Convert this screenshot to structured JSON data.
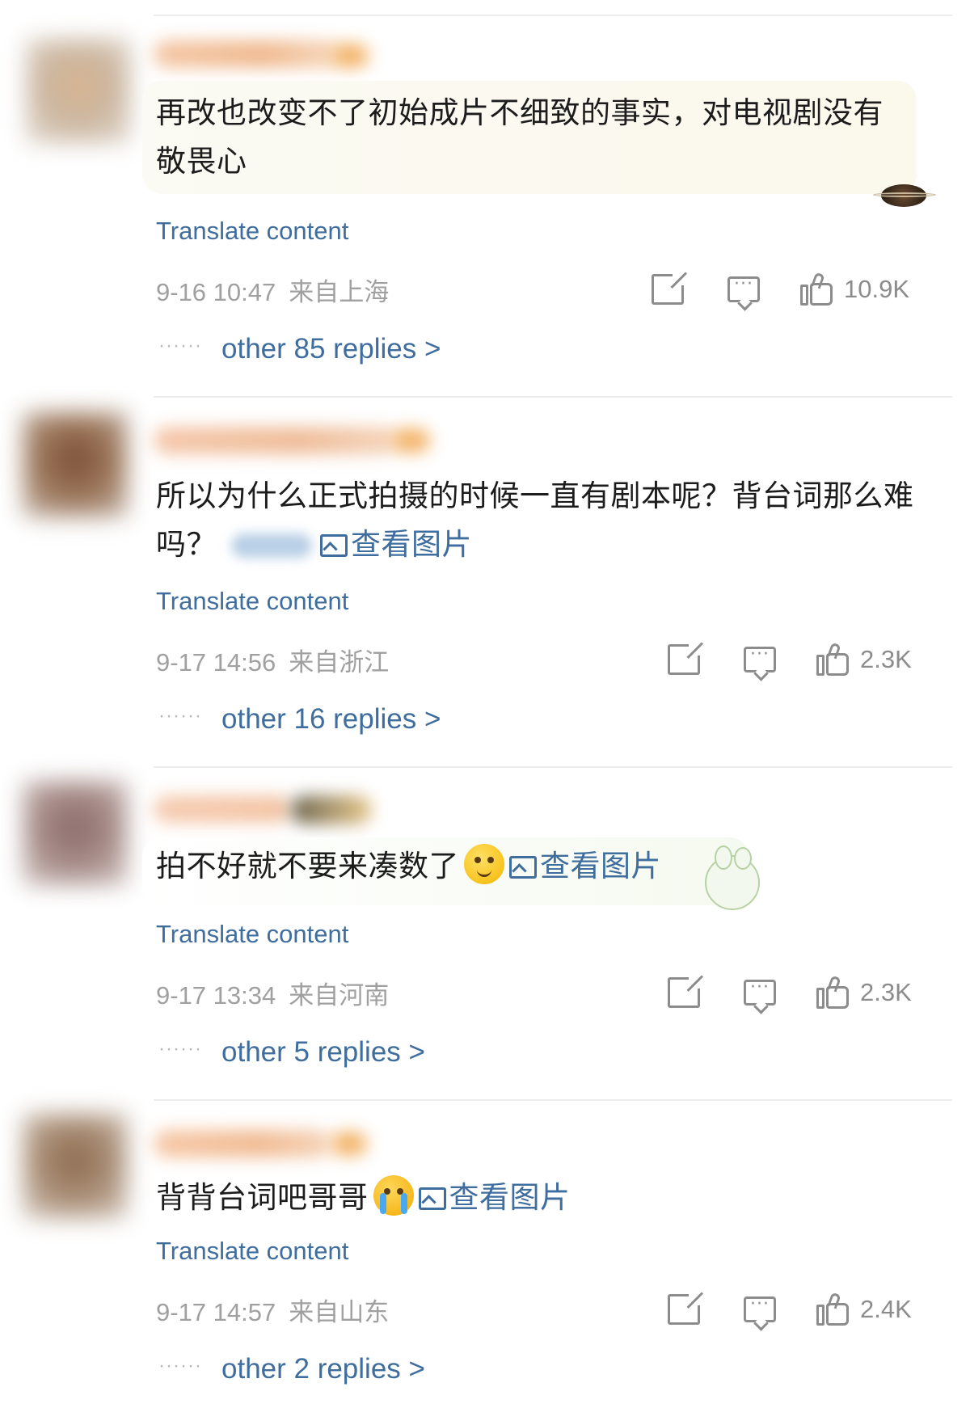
{
  "comments": [
    {
      "text_line1": "再改也改变不了初始成片不细致的事实，对电视剧没有",
      "text_line2": "敬畏心",
      "translate_label": "Translate content",
      "date": "9-16 10:47",
      "location": "来自上海",
      "likes": "10.9K",
      "replies_label": "other 85 replies >",
      "accent_color": "#f2b86b"
    },
    {
      "text_line1": "所以为什么正式拍摄的时候一直有剧本呢？背台词那么难",
      "text_line2": "吗？",
      "view_image_label": "查看图片",
      "translate_label": "Translate content",
      "date": "9-17 14:56",
      "location": "来自浙江",
      "likes": "2.3K",
      "replies_label": "other 16 replies >",
      "accent_color": "#f5c38a"
    },
    {
      "text_line1": "拍不好就不要来凑数了",
      "view_image_label": "查看图片",
      "translate_label": "Translate content",
      "date": "9-17 13:34",
      "location": "来自河南",
      "likes": "2.3K",
      "replies_label": "other 5 replies >",
      "accent_color": "#f6c98f"
    },
    {
      "text_line1": "背背台词吧哥哥",
      "view_image_label": "查看图片",
      "translate_label": "Translate content",
      "date": "9-17 14:57",
      "location": "来自山东",
      "likes": "2.4K",
      "replies_label": "other 2 replies >",
      "accent_color": "#f5bd80"
    }
  ],
  "theme": {
    "link_color": "#3e6d9e",
    "meta_color": "#a0a0a0",
    "icon_color": "#8c8c8c"
  },
  "icons": {
    "share": "share-icon",
    "comment": "comment-icon",
    "like": "thumbs-up-icon",
    "image": "image-icon"
  }
}
